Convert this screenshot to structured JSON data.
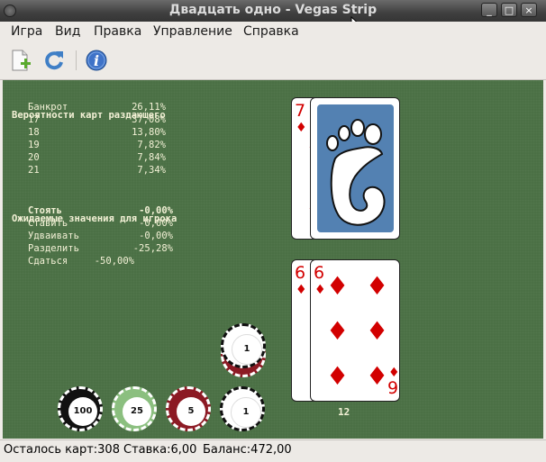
{
  "window": {
    "title": "Двадцать одно - Vegas Strip",
    "btn_minimize": "_",
    "btn_maximize": "□",
    "btn_close": "×"
  },
  "menu": {
    "items": [
      "Игра",
      "Вид",
      "Правка",
      "Управление",
      "Справка"
    ]
  },
  "toolbar": {
    "icons": [
      "new-game-icon",
      "restart-icon",
      "info-icon"
    ]
  },
  "dealer_probabilities": {
    "header": "Вероятности карт раздающего",
    "rows": [
      {
        "label": "Банкрот",
        "value": "26,11%"
      },
      {
        "label": "17",
        "value": "37,08%"
      },
      {
        "label": "18",
        "value": "13,80%"
      },
      {
        "label": "19",
        "value": "7,82%"
      },
      {
        "label": "20",
        "value": "7,84%"
      },
      {
        "label": "21",
        "value": "7,34%"
      }
    ]
  },
  "player_expected": {
    "header": "Ожидаемые значения для игрока",
    "rows": [
      {
        "label": "Стоять",
        "value": "-0,00%",
        "bold": true
      },
      {
        "label": "Ставить",
        "value": "-0,00%"
      },
      {
        "label": "Удваивать",
        "value": "-0,00%"
      },
      {
        "label": "Разделить",
        "value": "-25,28%"
      },
      {
        "label": "Сдаться",
        "value": "-50,00%"
      }
    ]
  },
  "dealer_hand": {
    "cards": [
      {
        "rank": "7",
        "suit": "♦"
      },
      {
        "face_down": true
      }
    ]
  },
  "player_hand": {
    "cards": [
      {
        "rank": "6",
        "suit": "♦"
      },
      {
        "rank": "6",
        "suit": "♦"
      },
      {
        "rank": "9",
        "suit": "♦"
      }
    ],
    "total": "12"
  },
  "chips": [
    {
      "value": "100",
      "color": "#111111"
    },
    {
      "value": "25",
      "color": "#8bbf7f"
    },
    {
      "value": "5",
      "color": "#8c1a24"
    },
    {
      "value": "1",
      "color": "#ffffff"
    }
  ],
  "bet_chip": {
    "value": "1"
  },
  "status": {
    "cards_left": "Осталось карт:308",
    "bet": "Ставка:6,00",
    "balance": "Баланс:472,00"
  }
}
